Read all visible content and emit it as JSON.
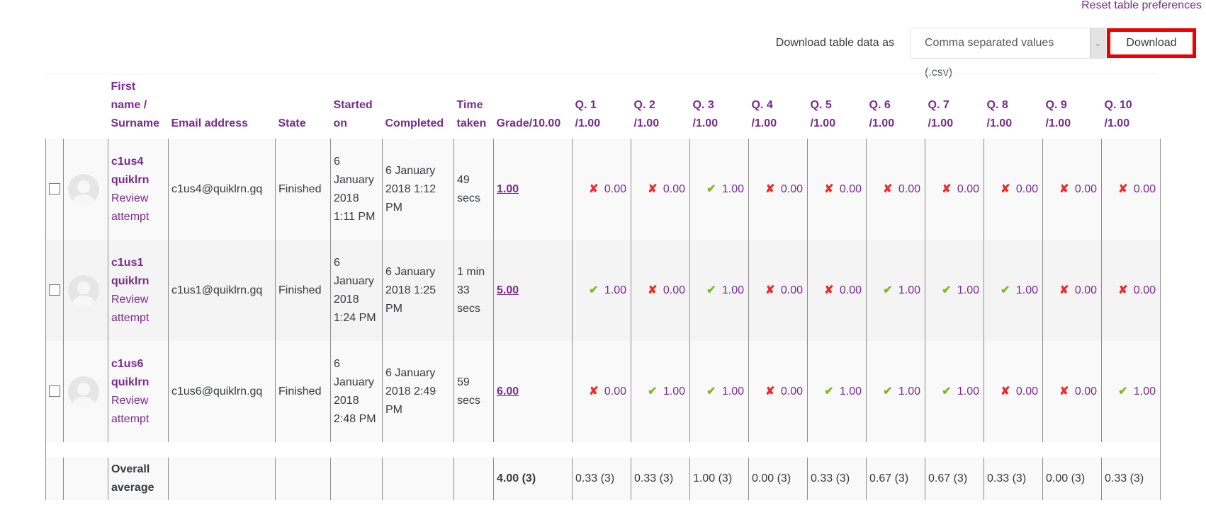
{
  "reset_link": "Reset table preferences",
  "download": {
    "label": "Download table data as",
    "format_selected": "Comma separated values (.csv)",
    "button": "Download",
    "highlight_color": "#ee0000"
  },
  "colors": {
    "link_purple": "#7a2a90",
    "correct_green": "#7bbb1e",
    "wrong_red": "#ee2b2b"
  },
  "headers": {
    "name": "First name / Surname",
    "email": "Email address",
    "state": "State",
    "started": "Started on",
    "completed": "Completed",
    "time": "Time taken",
    "grade": "Grade/10.00",
    "questions": [
      {
        "q": "Q. 1",
        "max": "/1.00"
      },
      {
        "q": "Q. 2",
        "max": "/1.00"
      },
      {
        "q": "Q. 3",
        "max": "/1.00"
      },
      {
        "q": "Q. 4",
        "max": "/1.00"
      },
      {
        "q": "Q. 5",
        "max": "/1.00"
      },
      {
        "q": "Q. 6",
        "max": "/1.00"
      },
      {
        "q": "Q. 7",
        "max": "/1.00"
      },
      {
        "q": "Q. 8",
        "max": "/1.00"
      },
      {
        "q": "Q. 9",
        "max": "/1.00"
      },
      {
        "q": "Q. 10",
        "max": "/1.00"
      }
    ]
  },
  "rows": [
    {
      "name": "c1us4 quiklrn",
      "review": "Review attempt",
      "email": "c1us4@quiklrn.gq",
      "state": "Finished",
      "started": "6 January 2018 1:11 PM",
      "completed": "6 January 2018 1:12 PM",
      "time": "49 secs",
      "grade": "1.00",
      "questions": [
        {
          "status": "wrong",
          "value": "0.00"
        },
        {
          "status": "wrong",
          "value": "0.00"
        },
        {
          "status": "correct",
          "value": "1.00"
        },
        {
          "status": "wrong",
          "value": "0.00"
        },
        {
          "status": "wrong",
          "value": "0.00"
        },
        {
          "status": "wrong",
          "value": "0.00"
        },
        {
          "status": "wrong",
          "value": "0.00"
        },
        {
          "status": "wrong",
          "value": "0.00"
        },
        {
          "status": "wrong",
          "value": "0.00"
        },
        {
          "status": "wrong",
          "value": "0.00"
        }
      ]
    },
    {
      "name": "c1us1 quiklrn",
      "review": "Review attempt",
      "email": "c1us1@quiklrn.gq",
      "state": "Finished",
      "started": "6 January 2018 1:24 PM",
      "completed": "6 January 2018 1:25 PM",
      "time": "1 min 33 secs",
      "grade": "5.00",
      "questions": [
        {
          "status": "correct",
          "value": "1.00"
        },
        {
          "status": "wrong",
          "value": "0.00"
        },
        {
          "status": "correct",
          "value": "1.00"
        },
        {
          "status": "wrong",
          "value": "0.00"
        },
        {
          "status": "wrong",
          "value": "0.00"
        },
        {
          "status": "correct",
          "value": "1.00"
        },
        {
          "status": "correct",
          "value": "1.00"
        },
        {
          "status": "correct",
          "value": "1.00"
        },
        {
          "status": "wrong",
          "value": "0.00"
        },
        {
          "status": "wrong",
          "value": "0.00"
        }
      ]
    },
    {
      "name": "c1us6 quiklrn",
      "review": "Review attempt",
      "email": "c1us6@quiklrn.gq",
      "state": "Finished",
      "started": "6 January 2018 2:48 PM",
      "completed": "6 January 2018 2:49 PM",
      "time": "59 secs",
      "grade": "6.00",
      "questions": [
        {
          "status": "wrong",
          "value": "0.00"
        },
        {
          "status": "correct",
          "value": "1.00"
        },
        {
          "status": "correct",
          "value": "1.00"
        },
        {
          "status": "wrong",
          "value": "0.00"
        },
        {
          "status": "correct",
          "value": "1.00"
        },
        {
          "status": "correct",
          "value": "1.00"
        },
        {
          "status": "correct",
          "value": "1.00"
        },
        {
          "status": "wrong",
          "value": "0.00"
        },
        {
          "status": "wrong",
          "value": "0.00"
        },
        {
          "status": "correct",
          "value": "1.00"
        }
      ]
    }
  ],
  "average": {
    "label": "Overall average",
    "grade": "4.00 (3)",
    "questions": [
      "0.33 (3)",
      "0.33 (3)",
      "1.00 (3)",
      "0.00 (3)",
      "0.33 (3)",
      "0.67 (3)",
      "0.67 (3)",
      "0.33 (3)",
      "0.00 (3)",
      "0.33 (3)"
    ]
  },
  "icons": {
    "correct": "check-icon",
    "wrong": "cross-icon",
    "select_arrow": "chevron-down-icon"
  }
}
